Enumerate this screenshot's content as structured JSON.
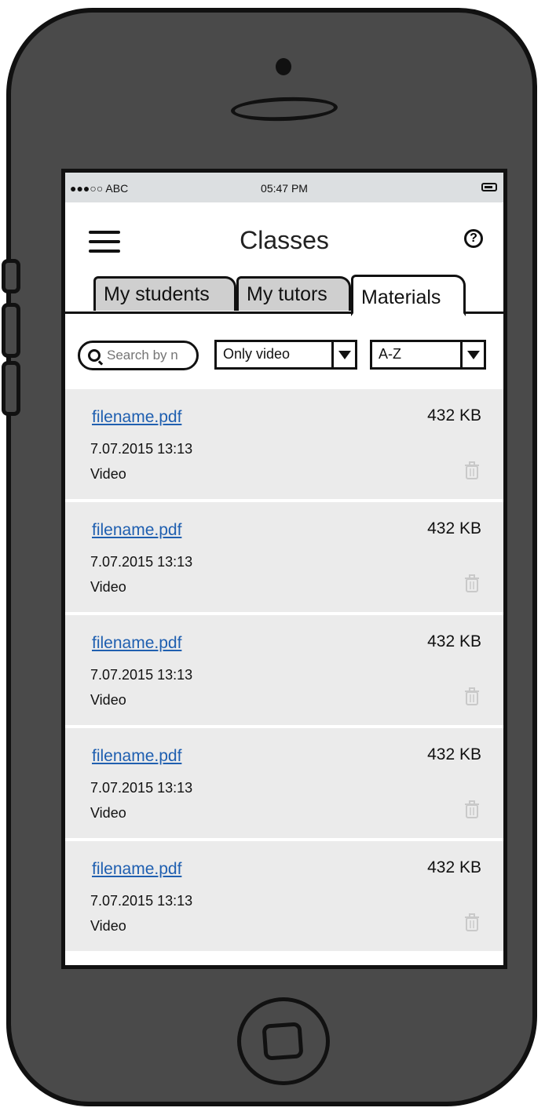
{
  "status": {
    "carrier": "●●●○○ ABC",
    "time": "05:47 PM"
  },
  "header": {
    "title": "Classes",
    "help_label": "?"
  },
  "tabs": [
    {
      "label": "My students"
    },
    {
      "label": "My tutors"
    },
    {
      "label": "Materials"
    }
  ],
  "filters": {
    "search_placeholder": "Search by n",
    "type_select": "Only video",
    "sort_select": "A-Z"
  },
  "files": [
    {
      "name": "filename.pdf",
      "size": "432 KB",
      "date": "7.07.2015 13:13",
      "type": "Video"
    },
    {
      "name": "filename.pdf",
      "size": "432 KB",
      "date": "7.07.2015 13:13",
      "type": "Video"
    },
    {
      "name": "filename.pdf",
      "size": "432 KB",
      "date": "7.07.2015 13:13",
      "type": "Video"
    },
    {
      "name": "filename.pdf",
      "size": "432 KB",
      "date": "7.07.2015 13:13",
      "type": "Video"
    },
    {
      "name": "filename.pdf",
      "size": "432 KB",
      "date": "7.07.2015 13:13",
      "type": "Video"
    }
  ],
  "colors": {
    "link": "#1f5fb0",
    "row_bg": "#ebebeb",
    "status_bg": "#dcdfe1",
    "tab_inactive": "#cfcfcf",
    "phone_body": "#4a4a4a"
  }
}
